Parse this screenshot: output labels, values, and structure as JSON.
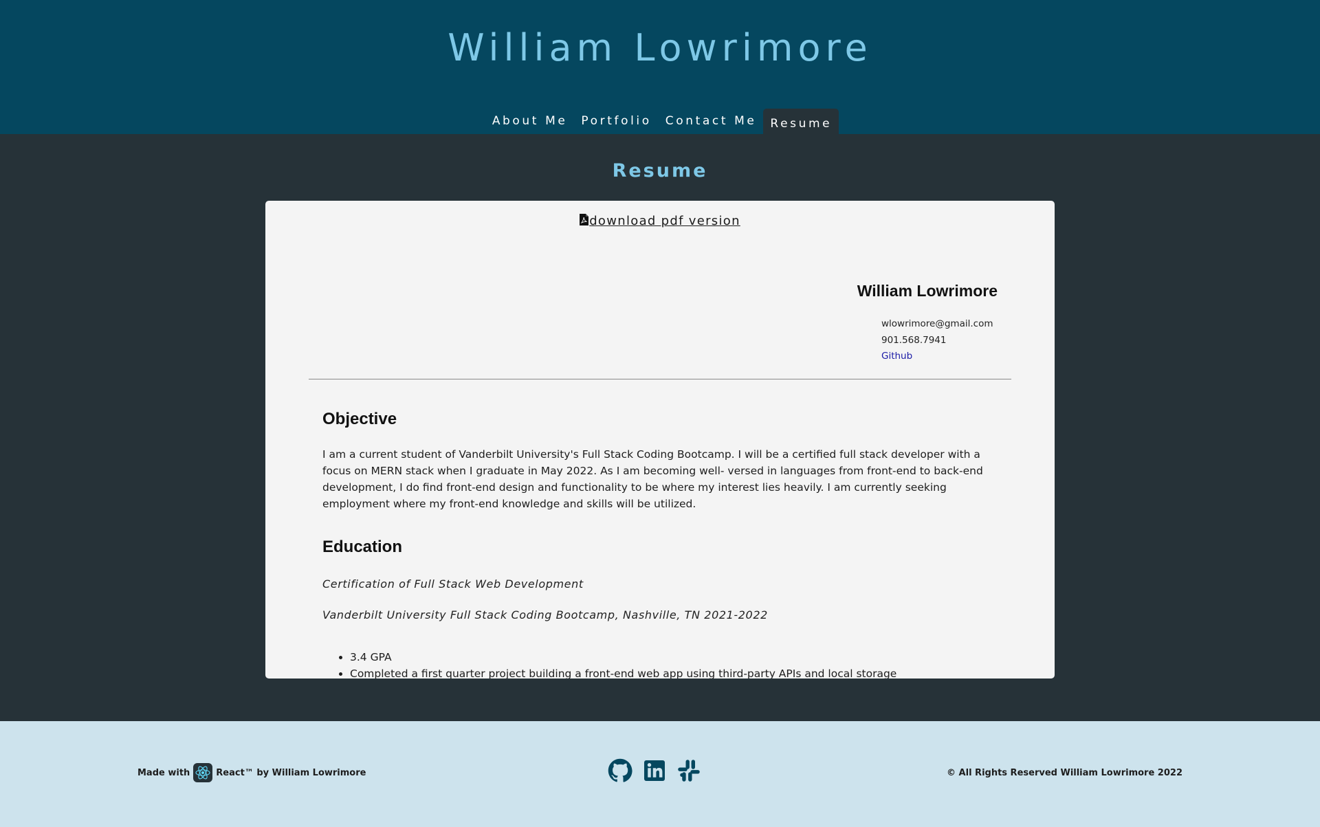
{
  "header": {
    "site_title": "William Lowrimore",
    "nav": [
      {
        "label": "About Me",
        "active": false
      },
      {
        "label": "Portfolio",
        "active": false
      },
      {
        "label": "Contact Me",
        "active": false
      },
      {
        "label": "Resume",
        "active": true
      }
    ]
  },
  "main": {
    "heading": "Resume",
    "download": {
      "icon": "pdf-file-icon",
      "label": "download pdf version"
    },
    "resume": {
      "name": "William Lowrimore",
      "email": "wlowrimore@gmail.com",
      "phone": "901.568.7941",
      "github_label": "Github",
      "objective_title": "Objective",
      "objective_text": "I am a current student of Vanderbilt University's Full Stack Coding Bootcamp. I will be a certified full stack developer with a focus on MERN stack when I graduate in May 2022. As I am becoming well- versed in languages from front-end to back-end development, I do find front-end design and functionality to be where my interest lies heavily. I am currently seeking employment where my front-end knowledge and skills will be utilized.",
      "education_title": "Education",
      "education_certification": "Certification of Full Stack Web Development",
      "education_school": "Vanderbilt University Full Stack Coding Bootcamp, Nashville, TN 2021-2022",
      "education_bullets": [
        "3.4 GPA",
        "Completed a first quarter project building a front-end web app using third-party APIs and local storage"
      ]
    }
  },
  "footer": {
    "made_with_prefix": "Made with",
    "made_with_suffix": "React™ by William Lowrimore",
    "social_icons": [
      "github-icon",
      "linkedin-icon",
      "slack-icon"
    ],
    "copyright": "© All Rights Reserved William Lowrimore 2022"
  },
  "colors": {
    "header_bg": "#05475f",
    "body_bg": "#263238",
    "accent": "#7ec8e7",
    "card_bg": "#f4f4f4",
    "footer_bg": "#cde3ed",
    "icon_color": "#05475f"
  }
}
